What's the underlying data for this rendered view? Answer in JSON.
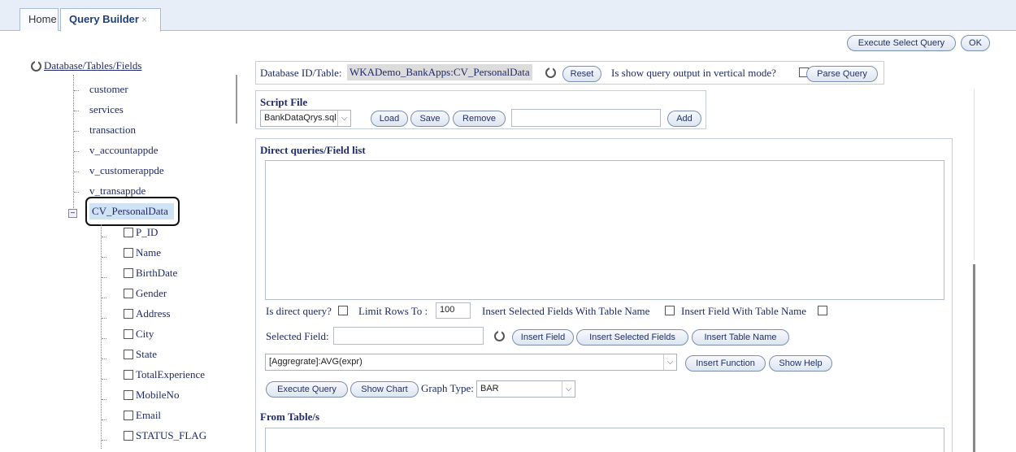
{
  "tabs": {
    "home": "Home",
    "query_builder": "Query Builder",
    "close": "×"
  },
  "top_buttons": {
    "execute_select": "Execute Select Query",
    "ok": "OK"
  },
  "tree": {
    "root": "Database/Tables/Fields",
    "tables": [
      "customer",
      "services",
      "transaction",
      "v_accountappde",
      "v_customerappde",
      "v_transappde"
    ],
    "selected_table": "CV_PersonalData",
    "fields": [
      "P_ID",
      "Name",
      "BirthDate",
      "Gender",
      "Address",
      "City",
      "State",
      "TotalExperience",
      "MobileNo",
      "Email",
      "STATUS_FLAG"
    ]
  },
  "db_bar": {
    "label": "Database ID/Table:",
    "value": "WKADemo_BankApps:CV_PersonalData",
    "reset": "Reset",
    "vertical_label": "Is show query output in vertical mode?",
    "parse": "Parse Query"
  },
  "script": {
    "title": "Script File",
    "file": "BankDataQrys.sql",
    "load": "Load",
    "save": "Save",
    "remove": "Remove",
    "add": "Add"
  },
  "direct": {
    "title": "Direct queries/Field list",
    "is_direct": "Is direct query?",
    "limit_label": "Limit Rows To :",
    "limit_value": "100",
    "insert_sel_tbl": "Insert Selected Fields With Table Name",
    "insert_field_tbl": "Insert Field With Table Name",
    "selected_field": "Selected Field:",
    "insert_field": "Insert Field",
    "insert_selected": "Insert Selected Fields",
    "insert_table": "Insert Table Name",
    "function": "[Aggregrate]:AVG(expr)",
    "insert_function": "Insert Function",
    "show_help": "Show Help",
    "execute_query": "Execute Query",
    "show_chart": "Show Chart",
    "graph_type_label": "Graph Type:",
    "graph_type": "BAR"
  },
  "from": {
    "title": "From Table/s"
  }
}
